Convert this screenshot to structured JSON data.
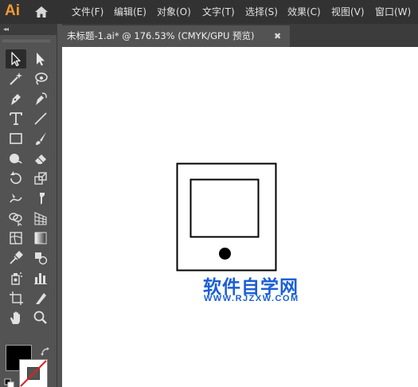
{
  "app": {
    "logo_text": "Ai"
  },
  "menu": [
    {
      "label": "文件(F)"
    },
    {
      "label": "编辑(E)"
    },
    {
      "label": "对象(O)"
    },
    {
      "label": "文字(T)"
    },
    {
      "label": "选择(S)"
    },
    {
      "label": "效果(C)"
    },
    {
      "label": "视图(V)"
    },
    {
      "label": "窗口(W)"
    }
  ],
  "document_tab": {
    "title": "未标题-1.ai* @ 176.53% (CMYK/GPU 预览)",
    "close": "✖"
  },
  "toolbar": {
    "collapse": "◂◂",
    "tools": [
      {
        "icon": "selection-tool-icon"
      },
      {
        "icon": "direct-selection-tool-icon"
      },
      {
        "icon": "magic-wand-tool-icon"
      },
      {
        "icon": "lasso-tool-icon"
      },
      {
        "icon": "pen-tool-icon"
      },
      {
        "icon": "curvature-tool-icon"
      },
      {
        "icon": "type-tool-icon"
      },
      {
        "icon": "line-segment-tool-icon"
      },
      {
        "icon": "rectangle-tool-icon"
      },
      {
        "icon": "paintbrush-tool-icon"
      },
      {
        "icon": "shaper-tool-icon"
      },
      {
        "icon": "eraser-tool-icon"
      },
      {
        "icon": "rotate-tool-icon"
      },
      {
        "icon": "scale-tool-icon"
      },
      {
        "icon": "warp-tool-icon"
      },
      {
        "icon": "puppet-warp-tool-icon"
      },
      {
        "icon": "shape-builder-tool-icon"
      },
      {
        "icon": "perspective-grid-tool-icon"
      },
      {
        "icon": "mesh-tool-icon"
      },
      {
        "icon": "gradient-tool-icon"
      },
      {
        "icon": "eyedropper-tool-icon"
      },
      {
        "icon": "blend-tool-icon"
      },
      {
        "icon": "symbol-sprayer-tool-icon"
      },
      {
        "icon": "column-graph-tool-icon"
      },
      {
        "icon": "artboard-tool-icon"
      },
      {
        "icon": "slice-tool-icon"
      },
      {
        "icon": "hand-tool-icon"
      },
      {
        "icon": "zoom-tool-icon"
      }
    ],
    "fill_color": "#000000",
    "stroke_color": "none"
  },
  "watermark": {
    "title": "软件自学网",
    "url": "WWW.RJZXW.COM",
    "color": "#1a5fd6"
  }
}
